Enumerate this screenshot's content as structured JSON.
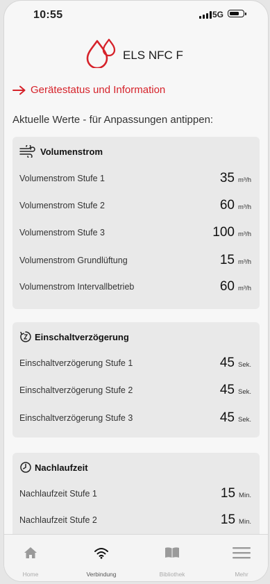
{
  "status_bar": {
    "time": "10:55",
    "network": "5G"
  },
  "header": {
    "title": "ELS NFC F"
  },
  "nav_link": {
    "label": "Gerätestatus und Information"
  },
  "intro": "Aktuelle Werte - für Anpassungen antippen:",
  "sections": [
    {
      "title": "Volumenstrom",
      "icon": "airflow-icon",
      "rows": [
        {
          "label": "Volumenstrom Stufe 1",
          "value": "35",
          "unit": "m³/h"
        },
        {
          "label": "Volumenstrom Stufe 2",
          "value": "60",
          "unit": "m³/h"
        },
        {
          "label": "Volumenstrom Stufe 3",
          "value": "100",
          "unit": "m³/h"
        },
        {
          "label": "Volumenstrom Grundlüftung",
          "value": "15",
          "unit": "m³/h"
        },
        {
          "label": "Volumenstrom Intervallbetrieb",
          "value": "60",
          "unit": "m³/h"
        }
      ]
    },
    {
      "title": "Einschaltverzögerung",
      "icon": "timer-icon",
      "rows": [
        {
          "label": "Einschaltverzögerung Stufe 1",
          "value": "45",
          "unit": "Sek."
        },
        {
          "label": "Einschaltverzögerung Stufe 2",
          "value": "45",
          "unit": "Sek."
        },
        {
          "label": "Einschaltverzögerung Stufe 3",
          "value": "45",
          "unit": "Sek."
        }
      ]
    },
    {
      "title": "Nachlaufzeit",
      "icon": "clock-icon",
      "rows": [
        {
          "label": "Nachlaufzeit Stufe 1",
          "value": "15",
          "unit": "Min."
        },
        {
          "label": "Nachlaufzeit Stufe 2",
          "value": "15",
          "unit": "Min."
        }
      ]
    }
  ],
  "tabbar": {
    "items": [
      {
        "label": "Home",
        "icon": "home-icon",
        "active": false
      },
      {
        "label": "Verbindung",
        "icon": "wifi-icon",
        "active": true
      },
      {
        "label": "Bibliothek",
        "icon": "book-icon",
        "active": false
      },
      {
        "label": "Mehr",
        "icon": "menu-icon",
        "active": false
      }
    ]
  },
  "colors": {
    "accent": "#d6222a",
    "card": "#e9e9e9",
    "background": "#f7f7f7"
  }
}
